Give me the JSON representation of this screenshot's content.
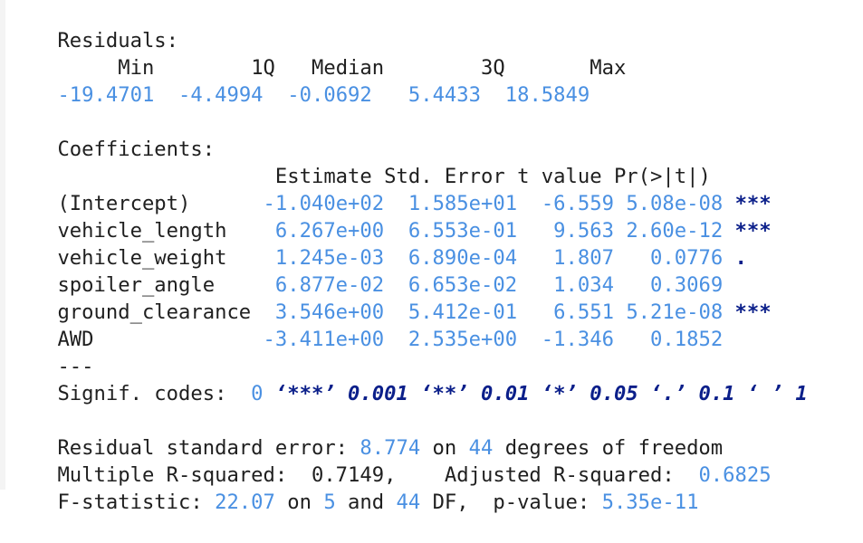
{
  "console": {
    "residuals_header": "Residuals:",
    "residuals_labels": [
      "Min",
      "1Q",
      "Median",
      "3Q",
      "Max"
    ],
    "residuals_values": [
      "-19.4701",
      "-4.4994",
      "-0.0692",
      "5.4433",
      "18.5849"
    ],
    "coefficients_header": "Coefficients:",
    "coef_cols": [
      "Estimate",
      "Std. Error",
      "t value",
      "Pr(>|t|)"
    ],
    "coef_rows": [
      {
        "name": "(Intercept)",
        "estimate": "-1.040e+02",
        "se": "1.585e+01",
        "t": "-6.559",
        "p": "5.08e-08",
        "sig": "***"
      },
      {
        "name": "vehicle_length",
        "estimate": "6.267e+00",
        "se": "6.553e-01",
        "t": "9.563",
        "p": "2.60e-12",
        "sig": "***"
      },
      {
        "name": "vehicle_weight",
        "estimate": "1.245e-03",
        "se": "6.890e-04",
        "t": "1.807",
        "p": "0.0776",
        "sig": "."
      },
      {
        "name": "spoiler_angle",
        "estimate": "6.877e-02",
        "se": "6.653e-02",
        "t": "1.034",
        "p": "0.3069",
        "sig": ""
      },
      {
        "name": "ground_clearance",
        "estimate": "3.546e+00",
        "se": "5.412e-01",
        "t": "6.551",
        "p": "5.21e-08",
        "sig": "***"
      },
      {
        "name": "AWD",
        "estimate": "-3.411e+00",
        "se": "2.535e+00",
        "t": "-1.346",
        "p": "0.1852",
        "sig": ""
      }
    ],
    "separator": "---",
    "signif_label": "Signif. codes:",
    "signif_codes": [
      "0",
      "‘***’",
      "0.001",
      "‘**’",
      "0.01",
      "‘*’",
      "0.05",
      "‘.’",
      "0.1",
      "‘ ’",
      "1"
    ],
    "rse_label": "Residual standard error:",
    "rse_value": "8.774",
    "rse_on": "on",
    "rse_df": "44",
    "rse_tail": "degrees of freedom",
    "mr2_label": "Multiple R-squared:",
    "mr2_value": "0.7149,",
    "adj_label": "Adjusted R-squared:",
    "adj_value": "0.6825",
    "f_label": "F-statistic:",
    "f_value": "22.07",
    "f_on": "on",
    "f_df1": "5",
    "f_and": "and",
    "f_df2": "44",
    "f_df_label": "DF,",
    "pval_label": "p-value:",
    "pval_value": "5.35e-11"
  }
}
